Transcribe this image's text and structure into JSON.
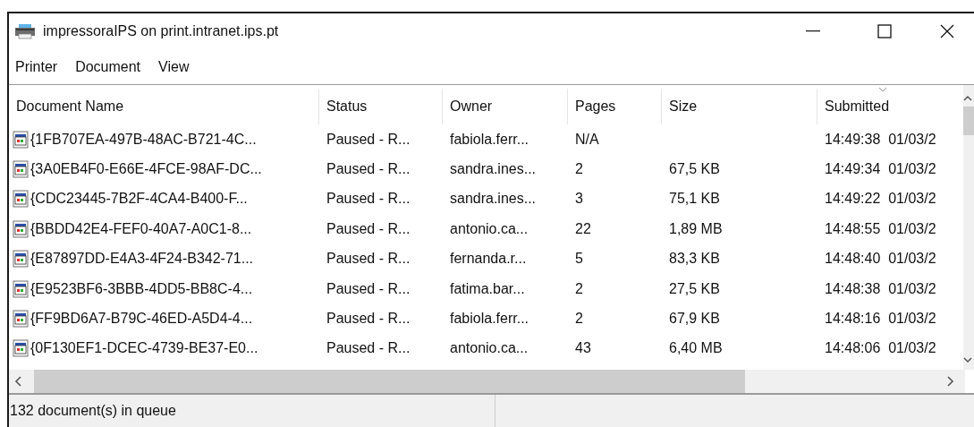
{
  "window": {
    "title": "impressoraIPS on print.intranet.ips.pt"
  },
  "menu": [
    "Printer",
    "Document",
    "View"
  ],
  "table": {
    "columns": [
      {
        "label": "Document Name",
        "sorted": false
      },
      {
        "label": "Status",
        "sorted": false
      },
      {
        "label": "Owner",
        "sorted": false
      },
      {
        "label": "Pages",
        "sorted": false
      },
      {
        "label": "Size",
        "sorted": false
      },
      {
        "label": "Submitted",
        "sorted": true
      }
    ],
    "rows": [
      [
        "{1FB707EA-497B-48AC-B721-4C...",
        "Paused - R...",
        "fabiola.ferr...",
        "N/A",
        "",
        "14:49:38  01/03/2"
      ],
      [
        "{3A0EB4F0-E66E-4FCE-98AF-DC...",
        "Paused - R...",
        "sandra.ines...",
        "2",
        "67,5 KB",
        "14:49:34  01/03/2"
      ],
      [
        "{CDC23445-7B2F-4CA4-B400-F...",
        "Paused - R...",
        "sandra.ines...",
        "3",
        "75,1 KB",
        "14:49:22  01/03/2"
      ],
      [
        "{BBDD42E4-FEF0-40A7-A0C1-8...",
        "Paused - R...",
        "antonio.ca...",
        "22",
        "1,89 MB",
        "14:48:55  01/03/2"
      ],
      [
        "{E87897DD-E4A3-4F24-B342-71...",
        "Paused - R...",
        "fernanda.r...",
        "5",
        "83,3 KB",
        "14:48:40  01/03/2"
      ],
      [
        "{E9523BF6-3BBB-4DD5-BB8C-4...",
        "Paused - R...",
        "fatima.bar...",
        "2",
        "27,5 KB",
        "14:48:38  01/03/2"
      ],
      [
        "{FF9BD6A7-B79C-46ED-A5D4-4...",
        "Paused - R...",
        "fabiola.ferr...",
        "2",
        "67,9 KB",
        "14:48:16  01/03/2"
      ],
      [
        "{0F130EF1-DCEC-4739-BE37-E0...",
        "Paused - R...",
        "antonio.ca...",
        "43",
        "6,40 MB",
        "14:48:06  01/03/2"
      ]
    ]
  },
  "status_bar": "132 document(s) in queue"
}
